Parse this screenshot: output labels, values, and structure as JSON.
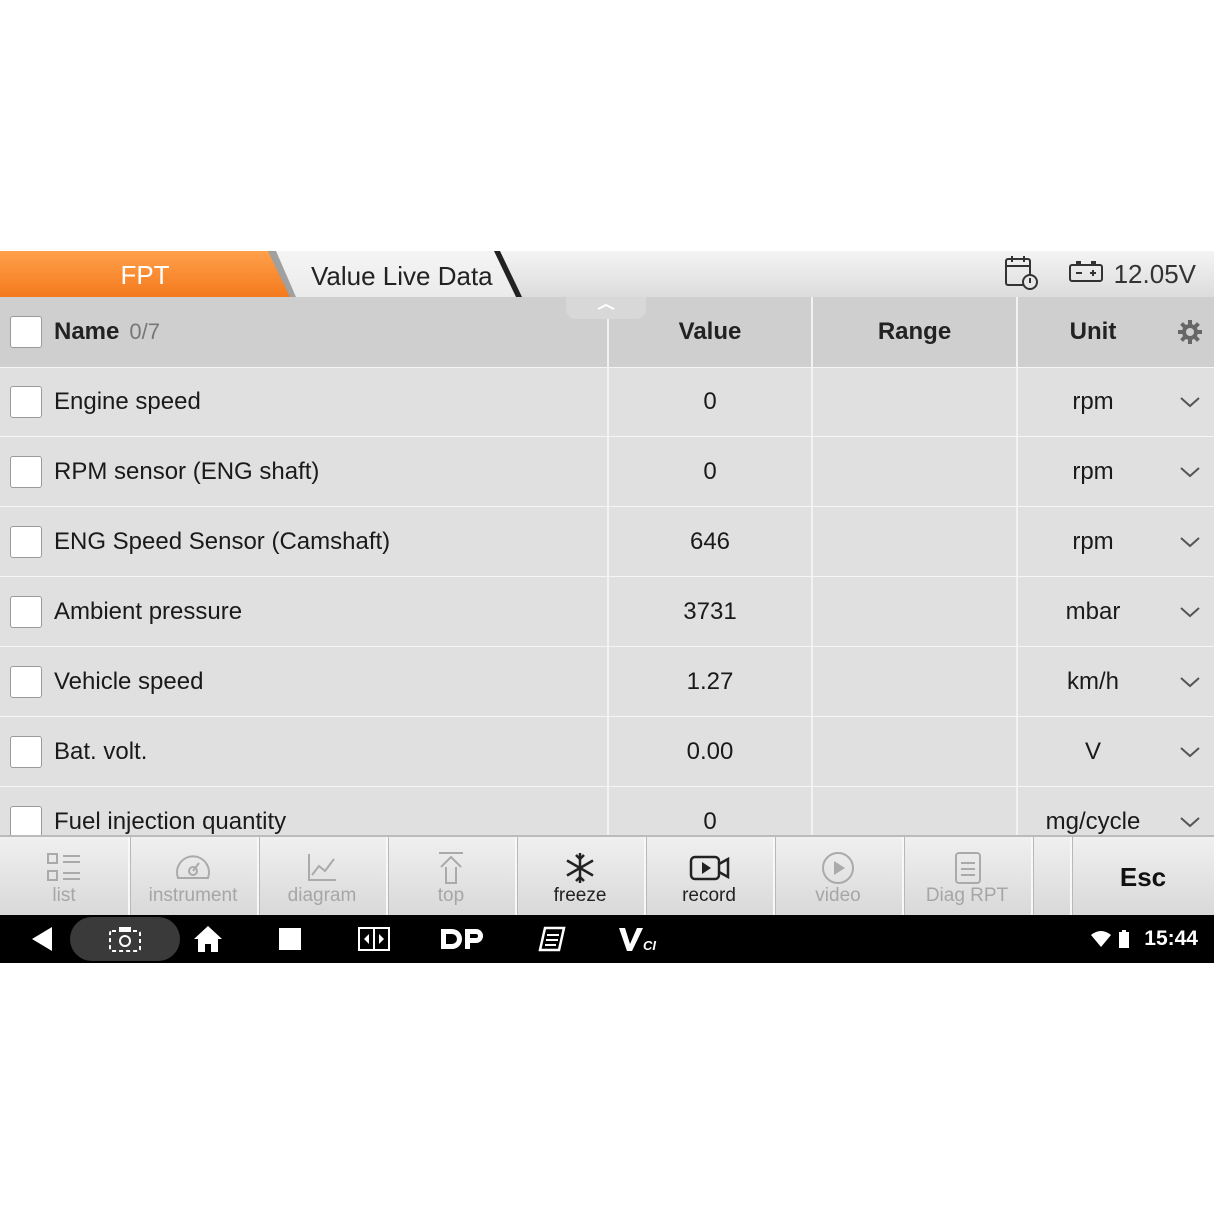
{
  "header": {
    "tab_active": "FPT",
    "tab_title": "Value Live Data",
    "voltage": "12.05V",
    "icons": [
      "calendar-clock-icon",
      "battery-icon"
    ],
    "accent": "#f58220"
  },
  "table": {
    "columns": {
      "name": "Name",
      "count": "0/7",
      "value": "Value",
      "range": "Range",
      "unit": "Unit"
    },
    "rows": [
      {
        "name": "Engine speed",
        "value": "0",
        "range": "",
        "unit": "rpm"
      },
      {
        "name": "RPM sensor (ENG shaft)",
        "value": "0",
        "range": "",
        "unit": "rpm"
      },
      {
        "name": "ENG Speed Sensor (Camshaft)",
        "value": "646",
        "range": "",
        "unit": "rpm"
      },
      {
        "name": "Ambient pressure",
        "value": "3731",
        "range": "",
        "unit": "mbar"
      },
      {
        "name": "Vehicle speed",
        "value": "1.27",
        "range": "",
        "unit": "km/h"
      },
      {
        "name": "Bat. volt.",
        "value": "0.00",
        "range": "",
        "unit": "V"
      },
      {
        "name": "Fuel injection quantity",
        "value": "0",
        "range": "",
        "unit": "mg/cycle"
      }
    ]
  },
  "toolbar": {
    "list": "list",
    "instrument": "instrument",
    "diagram": "diagram",
    "top": "top",
    "freeze": "freeze",
    "record": "record",
    "video": "video",
    "diag_rpt": "Diag RPT",
    "esc": "Esc"
  },
  "navbar": {
    "clock": "15:44",
    "icons": [
      "back-icon",
      "screenshot-icon",
      "home-icon",
      "recents-icon",
      "window-icon",
      "dp-logo-icon",
      "notes-icon",
      "vci-icon",
      "wifi-icon",
      "battery-status-icon"
    ]
  }
}
